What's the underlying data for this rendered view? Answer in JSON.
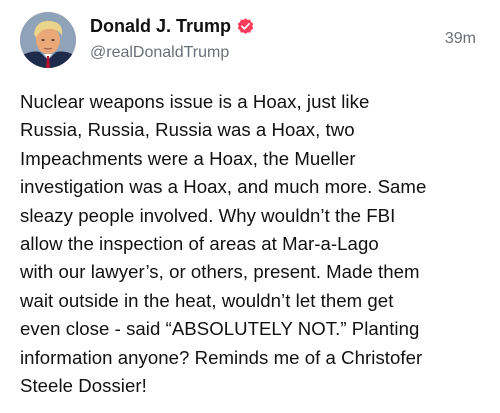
{
  "post": {
    "author": {
      "display_name": "Donald J. Trump",
      "handle": "@realDonaldTrump",
      "verified": true,
      "avatar_icon": "profile-photo-icon",
      "verified_icon": "verified-badge-icon",
      "verified_color": "#ff3b5c"
    },
    "timestamp": "39m",
    "text": "Nuclear weapons issue is a Hoax, just like\nRussia, Russia, Russia was a Hoax, two\nImpeachments were a Hoax, the Mueller\ninvestigation was a Hoax, and much more. Same\nsleazy people involved. Why wouldn’t the FBI\nallow the inspection of areas at Mar-a-Lago\nwith our lawyer’s, or others, present. Made them\nwait outside in the heat, wouldn’t let them get\neven close - said “ABSOLUTELY NOT.” Planting\ninformation anyone? Reminds me of a Christofer\nSteele Dossier!"
  }
}
